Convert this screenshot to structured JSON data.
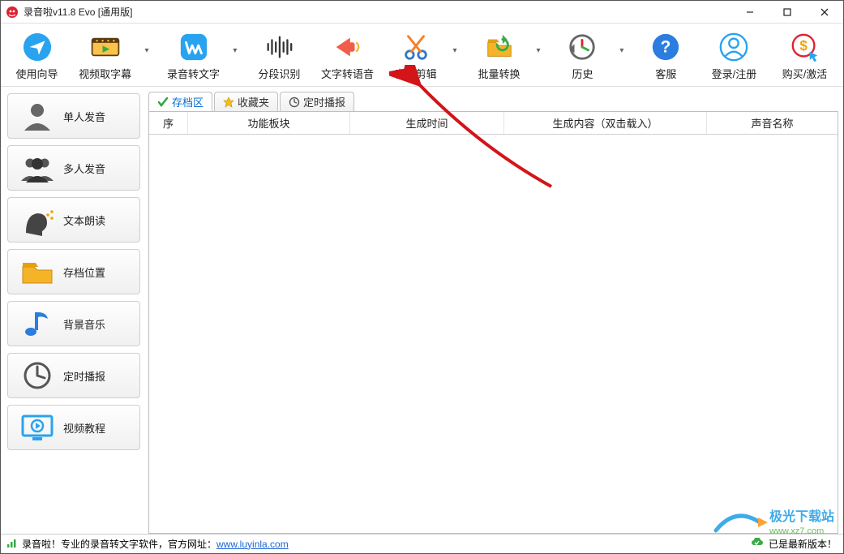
{
  "titlebar": {
    "title": "录音啦v11.8 Evo [通用版]"
  },
  "toolbar": {
    "items": [
      {
        "key": "wizard",
        "label": "使用向导",
        "dd": false
      },
      {
        "key": "subtitles",
        "label": "视频取字幕",
        "dd": true
      },
      {
        "key": "rec2text",
        "label": "录音转文字",
        "dd": true
      },
      {
        "key": "segment",
        "label": "分段识别",
        "dd": false
      },
      {
        "key": "tts",
        "label": "文字转语音",
        "dd": false
      },
      {
        "key": "audioedit",
        "label": "音频剪辑",
        "dd": true
      },
      {
        "key": "batch",
        "label": "批量转换",
        "dd": true
      },
      {
        "key": "history",
        "label": "历史",
        "dd": true
      },
      {
        "key": "support",
        "label": "客服",
        "dd": false
      },
      {
        "key": "login",
        "label": "登录/注册",
        "dd": false
      },
      {
        "key": "buy",
        "label": "购买/激活",
        "dd": false
      }
    ]
  },
  "sidebar": {
    "items": [
      {
        "key": "single",
        "label": "单人发音"
      },
      {
        "key": "multi",
        "label": "多人发音"
      },
      {
        "key": "readtext",
        "label": "文本朗读"
      },
      {
        "key": "archive",
        "label": "存档位置"
      },
      {
        "key": "bgm",
        "label": "背景音乐"
      },
      {
        "key": "timed",
        "label": "定时播报"
      },
      {
        "key": "videotut",
        "label": "视频教程"
      }
    ]
  },
  "tabs": {
    "items": [
      {
        "key": "archive",
        "label": "存档区",
        "active": true
      },
      {
        "key": "favorite",
        "label": "收藏夹",
        "active": false
      },
      {
        "key": "timed",
        "label": "定时播报",
        "active": false
      }
    ]
  },
  "table": {
    "columns": [
      {
        "key": "seq",
        "label": "序"
      },
      {
        "key": "module",
        "label": "功能板块"
      },
      {
        "key": "gentime",
        "label": "生成时间"
      },
      {
        "key": "gencontent",
        "label": "生成内容（双击载入）"
      },
      {
        "key": "voicename",
        "label": "声音名称"
      }
    ]
  },
  "statusbar": {
    "left_prefix": "录音啦！专业的录音转文字软件，官方网址：",
    "url": "www.luyinla.com",
    "right": "已是最新版本！"
  },
  "watermark": {
    "brand": "极光下载站",
    "url": "www.xz7.com"
  },
  "colors": {
    "accent": "#0a6ed1",
    "arrow": "#d31418",
    "green": "#3aab47",
    "orange": "#f57f29",
    "blue": "#29a3ef"
  }
}
